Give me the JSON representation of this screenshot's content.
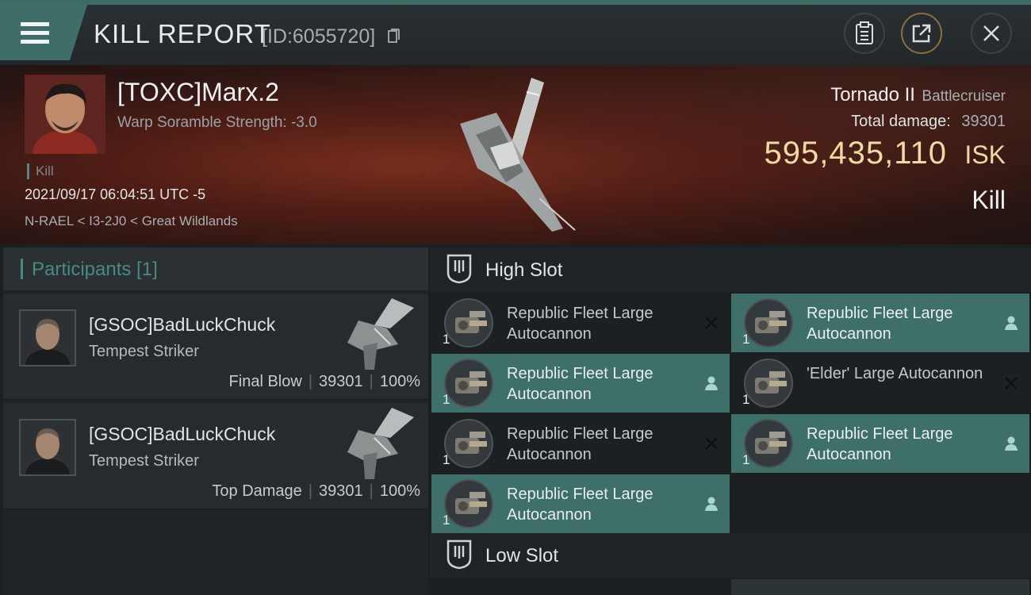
{
  "header": {
    "title": "KILL REPORT",
    "report_id": "[ID:6055720]",
    "icons": [
      "menu-icon",
      "copy-icon",
      "clipboard-icon",
      "share-icon",
      "close-icon"
    ]
  },
  "victim": {
    "name": "[TOXC]Marx.2",
    "warp_scramble": "Warp Soramble Strength: -3.0",
    "kill_tag": "Kill",
    "datetime": "2021/09/17 06:04:51 UTC -5",
    "location": "N-RAEL < I3-2J0 < Great Wildlands",
    "ship_name": "Tornado II",
    "ship_class": "Battlecruiser",
    "total_damage_label": "Total damage:",
    "total_damage": "39301",
    "isk_value": "595,435,110",
    "isk_unit": "ISK",
    "status": "Kill"
  },
  "participants": {
    "title": "Participants [1]",
    "items": [
      {
        "name": "[GSOC]BadLuckChuck",
        "ship": "Tempest Striker",
        "role": "Final Blow",
        "damage": "39301",
        "percent": "100%"
      },
      {
        "name": "[GSOC]BadLuckChuck",
        "ship": "Tempest Striker",
        "role": "Top Damage",
        "damage": "39301",
        "percent": "100%"
      }
    ]
  },
  "high_slot": {
    "title": "High Slot",
    "modules": [
      {
        "name": "Republic Fleet Large Autocannon",
        "qty": "1",
        "status": "destroyed"
      },
      {
        "name": "Republic Fleet Large Autocannon",
        "qty": "1",
        "status": "dropped"
      },
      {
        "name": "Republic Fleet Large Autocannon",
        "qty": "1",
        "status": "dropped"
      },
      {
        "name": "'Elder' Large Autocannon",
        "qty": "1",
        "status": "destroyed"
      },
      {
        "name": "Republic Fleet Large Autocannon",
        "qty": "1",
        "status": "destroyed"
      },
      {
        "name": "Republic Fleet Large Autocannon",
        "qty": "1",
        "status": "dropped"
      },
      {
        "name": "Republic Fleet Large Autocannon",
        "qty": "1",
        "status": "dropped"
      }
    ]
  },
  "low_slot": {
    "title": "Low Slot"
  }
}
